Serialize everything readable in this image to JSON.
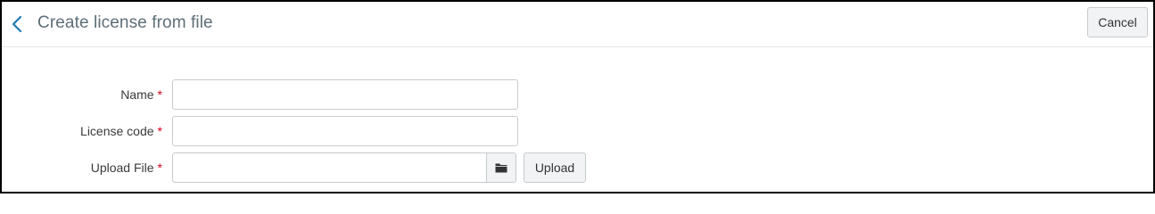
{
  "header": {
    "title": "Create license from file",
    "cancel_label": "Cancel",
    "back_icon": "chevron-left-icon"
  },
  "form": {
    "required_marker": "*",
    "fields": [
      {
        "label": "Name",
        "value": "",
        "placeholder": ""
      },
      {
        "label": "License code",
        "value": "",
        "placeholder": ""
      },
      {
        "label": "Upload File",
        "value": "",
        "placeholder": ""
      }
    ],
    "browse_icon": "folder-icon",
    "upload_label": "Upload"
  },
  "colors": {
    "accent": "#1c7ab8",
    "required": "#d0021b",
    "title": "#5e6e78"
  }
}
